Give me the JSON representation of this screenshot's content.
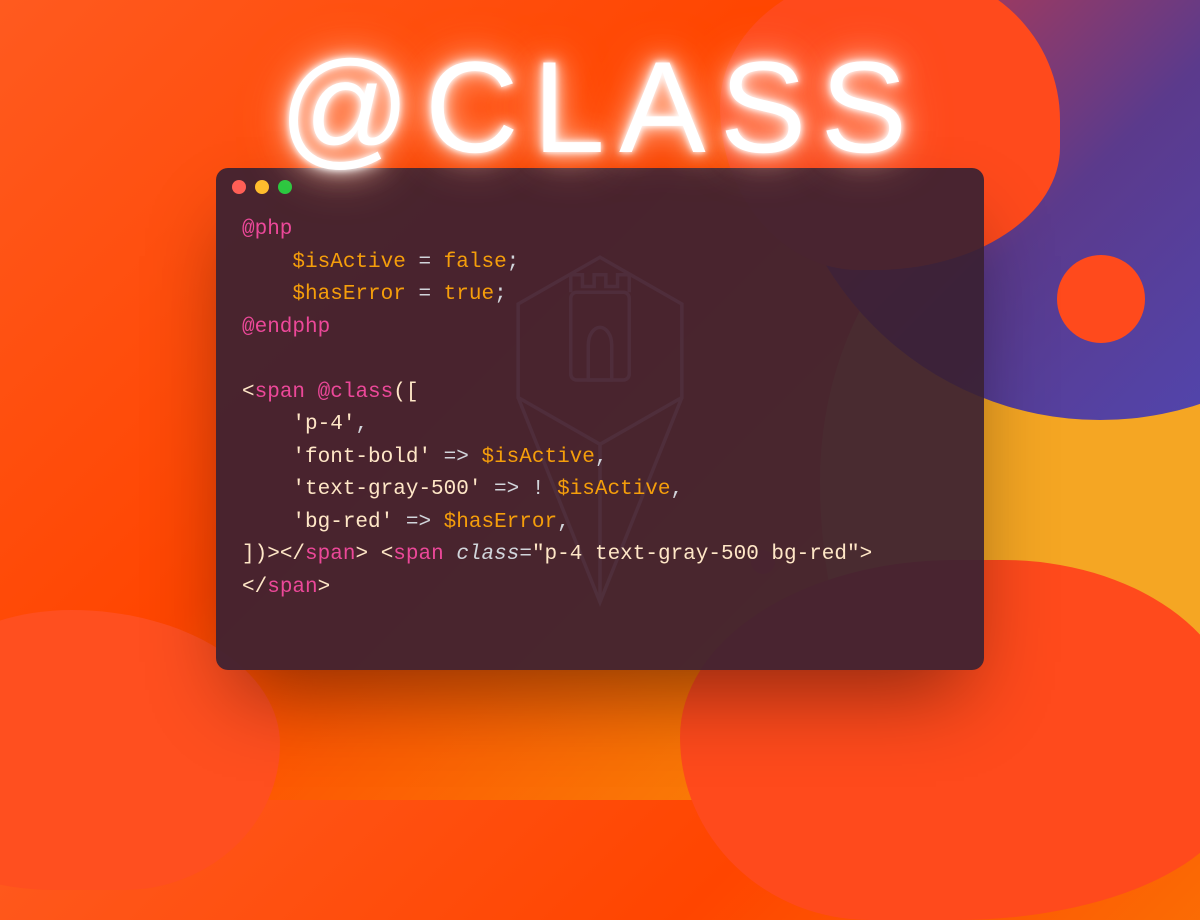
{
  "heading": "@CLASS",
  "traffic_lights": {
    "red": "#ff5f56",
    "yellow": "#ffbd2e",
    "green": "#27c93f"
  },
  "colors": {
    "directive": "#ec4899",
    "variable": "#f59e0b",
    "string": "#ffe7c7",
    "operator": "#d1d5db",
    "window_bg": "rgba(58,33,50,0.92)"
  },
  "code": {
    "l1": {
      "dir": "@php"
    },
    "l2": {
      "var": "$isActive",
      "eq": " = ",
      "val": "false",
      "semi": ";"
    },
    "l3": {
      "var": "$hasError",
      "eq": " = ",
      "val": "true",
      "semi": ";"
    },
    "l4": {
      "dir": "@endphp"
    },
    "l5_open": "<",
    "l5_tag": "span",
    "l5_space": " ",
    "l5_class_dir": "@class",
    "l5_paren": "([",
    "l6_str": "'p-4'",
    "l6_comma": ",",
    "l7_str": "'font-bold'",
    "l7_arrow": " => ",
    "l7_var": "$isActive",
    "l7_comma": ",",
    "l8_str": "'text-gray-500'",
    "l8_arrow": " => ",
    "l8_neg": "! ",
    "l8_var": "$isActive",
    "l8_comma": ",",
    "l9_str": "'bg-red'",
    "l9_arrow": " => ",
    "l9_var": "$hasError",
    "l9_comma": ",",
    "l10_close_arr": "])",
    "l10_gt": ">",
    "l10_close_span_open": "</",
    "l10_close_span_tag": "span",
    "l10_close_span_gt": ">",
    "l10_sp": " ",
    "l10_open2": "<",
    "l10_tag2": "span",
    "l10_sp2": " ",
    "l10_attr": "class",
    "l10_eq": "=",
    "l10_val": "\"p-4 text-gray-500 bg-red\"",
    "l10_gt2": ">",
    "l11_open": "</",
    "l11_tag": "span",
    "l11_gt": ">"
  }
}
